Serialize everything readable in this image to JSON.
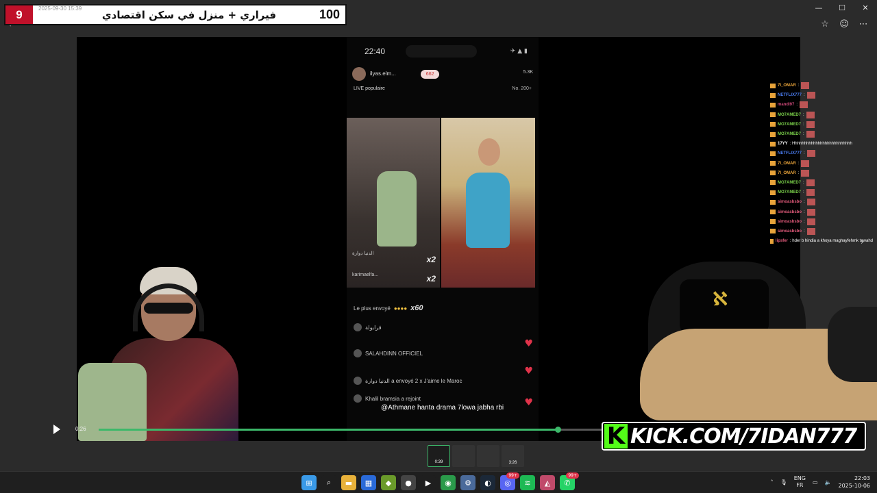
{
  "window": {
    "controls": [
      "—",
      "☐",
      "✕"
    ],
    "toolbar_icons": [
      "star-icon",
      "smiley-icon",
      "more-icon"
    ]
  },
  "overlay": {
    "number": "9",
    "date": "2025-09-30 15:39",
    "title": "فيراري + منزل في سكن اقتصادي",
    "score": "100"
  },
  "phone": {
    "time": "22:40",
    "username": "ilyas.elm...",
    "heart_count": "662",
    "viewers": "5.3K",
    "live_label": "LIVE populaire",
    "rank": "No. 200+",
    "left_cam_name": "karimaelfa...",
    "left_cam_top_name": "الدنيا دوارة",
    "mult1": "x2",
    "mult2": "x2",
    "most_sent": "Le plus envoyé",
    "most_sent_count": "x60",
    "chat": [
      "قرابولة",
      "SALAHDINN OFFICIEL",
      "الدنيا دوارة a envoyé 2 x J'aime le Maroc",
      "Khalil bramsia a rejoint"
    ],
    "subtitle": "@Athmane hanta drama 7lowa jabha rbi"
  },
  "side_chat": [
    {
      "name": "7I_OMAR",
      "color": "#e8a33a",
      "text": ":"
    },
    {
      "name": "NETFLIX777",
      "color": "#4a7cf0",
      "text": ":"
    },
    {
      "name": "mandi97",
      "color": "#d04a7a",
      "text": ":"
    },
    {
      "name": "MO7AMED7",
      "color": "#7ad04a",
      "text": ":"
    },
    {
      "name": "MO7AMED7",
      "color": "#7ad04a",
      "text": ":"
    },
    {
      "name": "MO7AMED7",
      "color": "#7ad04a",
      "text": ":"
    },
    {
      "name": "17YY",
      "color": "#ffffff",
      "text": ": Hhhhhhhhhhhhhhhhhhhhhhhhhh"
    },
    {
      "name": "NETFLIX777",
      "color": "#4a7cf0",
      "text": ":"
    },
    {
      "name": "7I_OMAR",
      "color": "#e8a33a",
      "text": ":"
    },
    {
      "name": "7I_OMAR",
      "color": "#e8a33a",
      "text": ":"
    },
    {
      "name": "MO7AMED7",
      "color": "#7ad04a",
      "text": ":"
    },
    {
      "name": "MO7AMED7",
      "color": "#7ad04a",
      "text": ":"
    },
    {
      "name": "simoasbsbo",
      "color": "#e05a7a",
      "text": ":"
    },
    {
      "name": "simoasbsbo",
      "color": "#e05a7a",
      "text": ":"
    },
    {
      "name": "simoasbsbo",
      "color": "#e05a7a",
      "text": ":"
    },
    {
      "name": "simoasbsbo",
      "color": "#e05a7a",
      "text": ":"
    },
    {
      "name": "lipsfer",
      "color": "#e05a7a",
      "text": ": hder b hindia a khoya maghayfehmk tawahd"
    }
  ],
  "player": {
    "current_time": "0:26",
    "progress": 0.91
  },
  "kick_banner": {
    "k": "K",
    "text": "KICK.COM/7IDAN777"
  },
  "thumbnails": [
    {
      "label": "0:39",
      "active": true
    },
    {
      "label": "",
      "active": false
    },
    {
      "label": "",
      "active": false
    },
    {
      "label": "3:26",
      "active": false
    }
  ],
  "taskbar": {
    "apps": [
      {
        "name": "start-icon",
        "glyph": "⊞",
        "color": "#3a9ae8"
      },
      {
        "name": "search-icon",
        "glyph": "⌕",
        "color": "#1f1f1f"
      },
      {
        "name": "file-explorer-icon",
        "glyph": "▬",
        "color": "#e8b13a"
      },
      {
        "name": "store-icon",
        "glyph": "▦",
        "color": "#2a6ad8"
      },
      {
        "name": "app-layers-icon",
        "glyph": "◆",
        "color": "#6a9a2a"
      },
      {
        "name": "app-red-icon",
        "glyph": "●",
        "color": "#444"
      },
      {
        "name": "play-icon",
        "glyph": "▶",
        "color": "#1f1f1f"
      },
      {
        "name": "chrome-icon",
        "glyph": "◉",
        "color": "#2a9a4a"
      },
      {
        "name": "settings-icon",
        "glyph": "⚙",
        "color": "#4a6a9a"
      },
      {
        "name": "steam-icon",
        "glyph": "◐",
        "color": "#1b2838"
      },
      {
        "name": "discord-icon",
        "glyph": "◎",
        "color": "#5865f2"
      },
      {
        "name": "spotify-icon",
        "glyph": "≋",
        "color": "#1db954"
      },
      {
        "name": "media-player-icon",
        "glyph": "◭",
        "color": "#c04a6a"
      },
      {
        "name": "whatsapp-icon",
        "glyph": "✆",
        "color": "#25d366"
      }
    ],
    "discord_badge": "99+",
    "whatsapp_badge": "99+",
    "lang_top": "ENG",
    "lang_bottom": "FR",
    "time": "22:03",
    "date": "2025-10-06"
  }
}
